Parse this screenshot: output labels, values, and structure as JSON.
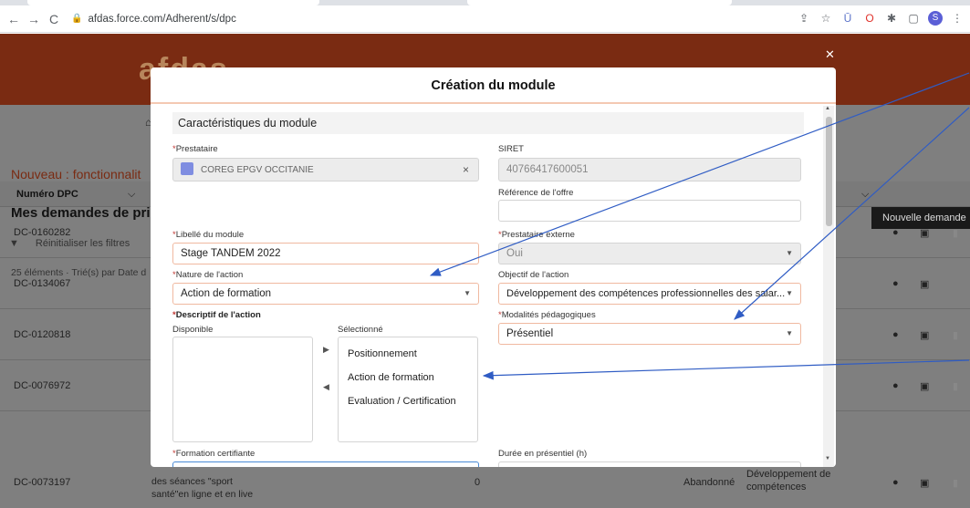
{
  "browser": {
    "url": "afdas.force.com/Adherent/s/dpc",
    "icons": [
      "back-icon",
      "forward-icon",
      "reload-icon",
      "lock-icon",
      "share-icon",
      "star-icon",
      "extension-icons",
      "profile-avatar"
    ],
    "profile_initial": "S"
  },
  "site": {
    "nouveau": "Nouveau : fonctionnalit",
    "mes_demandes": "Mes demandes de prise",
    "nouvelle_demande": "Nouvelle demande",
    "reinit_filters": "Réinitialiser les filtres",
    "elements": "25 éléments · Trié(s) par Date d",
    "col_numero": "Numéro DPC",
    "rows": [
      {
        "id": "DC-0160282"
      },
      {
        "id": "DC-0134067"
      },
      {
        "id": "DC-0120818"
      },
      {
        "id": "DC-0076972"
      },
      {
        "id": "DC-0073197",
        "desc1": "des séances \"sport",
        "desc2": "santé\"en ligne et en live",
        "count": "0",
        "status": "Abandonné",
        "objectif1": "Développement de",
        "objectif2": "compétences"
      }
    ]
  },
  "modal": {
    "title": "Création du module",
    "section": "Caractéristiques du module",
    "prestataire": {
      "label": "Prestataire",
      "value": "COREG EPGV OCCITANIE"
    },
    "siret": {
      "label": "SIRET",
      "value": "40766417600051"
    },
    "ref_offre": {
      "label": "Référence de l'offre",
      "value": ""
    },
    "libelle": {
      "label": "Libellé du module",
      "value": "Stage TANDEM 2022"
    },
    "prest_externe": {
      "label": "Prestataire externe",
      "value": "Oui"
    },
    "nature": {
      "label": "Nature de l'action",
      "value": "Action de formation"
    },
    "objectif": {
      "label": "Objectif de l'action",
      "value": "Développement des compétences professionnelles des salar..."
    },
    "descriptif": {
      "label": "Descriptif de l'action",
      "disponible": "Disponible",
      "selectionne": "Sélectionné",
      "selected_items": [
        "Positionnement",
        "Action de formation",
        "Evaluation / Certification"
      ]
    },
    "modalites": {
      "label": "Modalités pédagogiques",
      "value": "Présentiel"
    },
    "certifiante": {
      "label": "Formation certifiante"
    },
    "duree": {
      "label": "Durée en présentiel (h)"
    }
  },
  "colors": {
    "brand": "#7a2b12",
    "required": "#c23934",
    "annotation": "#2f5cc4"
  }
}
